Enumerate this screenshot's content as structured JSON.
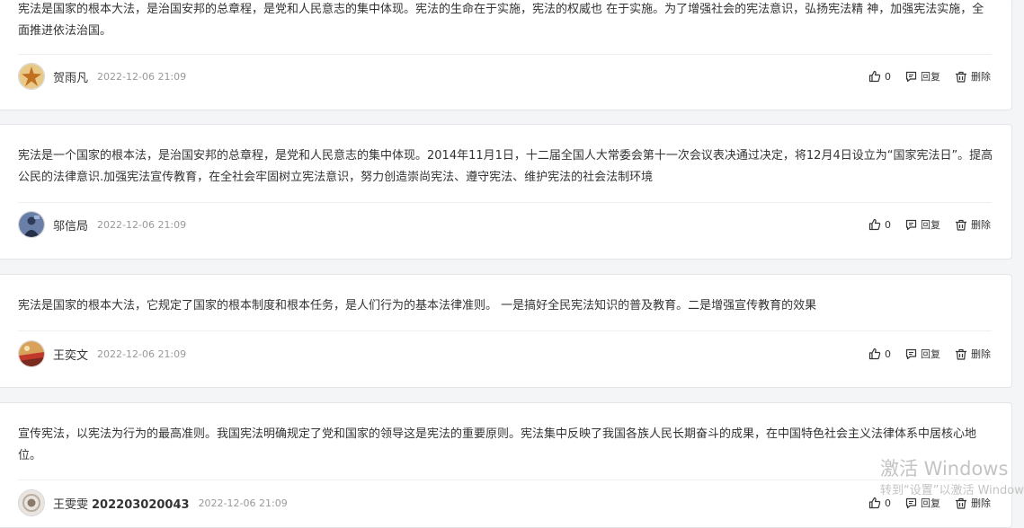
{
  "comments": [
    {
      "text": "宪法是国家的根本大法，是治国安邦的总章程，是党和人民意志的集中体现。宪法的生命在于实施，宪法的权威也 在于实施。为了增强社会的宪法意识，弘扬宪法精 神，加强宪法实施，全面推进依法治国。",
      "author": "贺雨凡",
      "author_id": "",
      "time": "2022-12-06 21:09",
      "likes": "0",
      "avatar": "starfish-avatar"
    },
    {
      "text": "宪法是一个国家的根本法，是治国安邦的总章程，是党和人民意志的集中体现。2014年11月1日，十二届全国人大常委会第十一次会议表决通过决定，将12月4日设立为“国家宪法日”。提高公民的法律意识.加强宪法宣传教育，在全社会牢固树立宪法意识，努力创造崇尚宪法、遵守宪法、维护宪法的社会法制环境",
      "author": "邬信局",
      "author_id": "",
      "time": "2022-12-06 21:09",
      "likes": "0",
      "avatar": "figure-avatar"
    },
    {
      "text": "宪法是国家的根本大法，它规定了国家的根本制度和根本任务，是人们行为的基本法律准则。 一是搞好全民宪法知识的普及教育。二是增强宣传教育的效果",
      "author": "王奕文",
      "author_id": "",
      "time": "2022-12-06 21:09",
      "likes": "0",
      "avatar": "sunset-avatar"
    },
    {
      "text": "宣传宪法，以宪法为行为的最高准则。我国宪法明确规定了党和国家的领导这是宪法的重要原则。宪法集中反映了我国各族人民长期奋斗的成果，在中国特色社会主义法律体系中居核心地位。",
      "author": "王雯雯",
      "author_id": "202203020043",
      "time": "2022-12-06 21:09",
      "likes": "0",
      "avatar": "portrait-avatar"
    }
  ],
  "actions": {
    "reply_label": "回复",
    "delete_label": "删除"
  },
  "watermark": {
    "line1": "激活 Windows",
    "line2": "转到“设置”以激活 Windows。"
  },
  "colors": {
    "background": "#f4f5f6",
    "card": "#ffffff",
    "border": "#e3e5e8",
    "time": "#999999",
    "watermark": "#c3c3c3"
  }
}
